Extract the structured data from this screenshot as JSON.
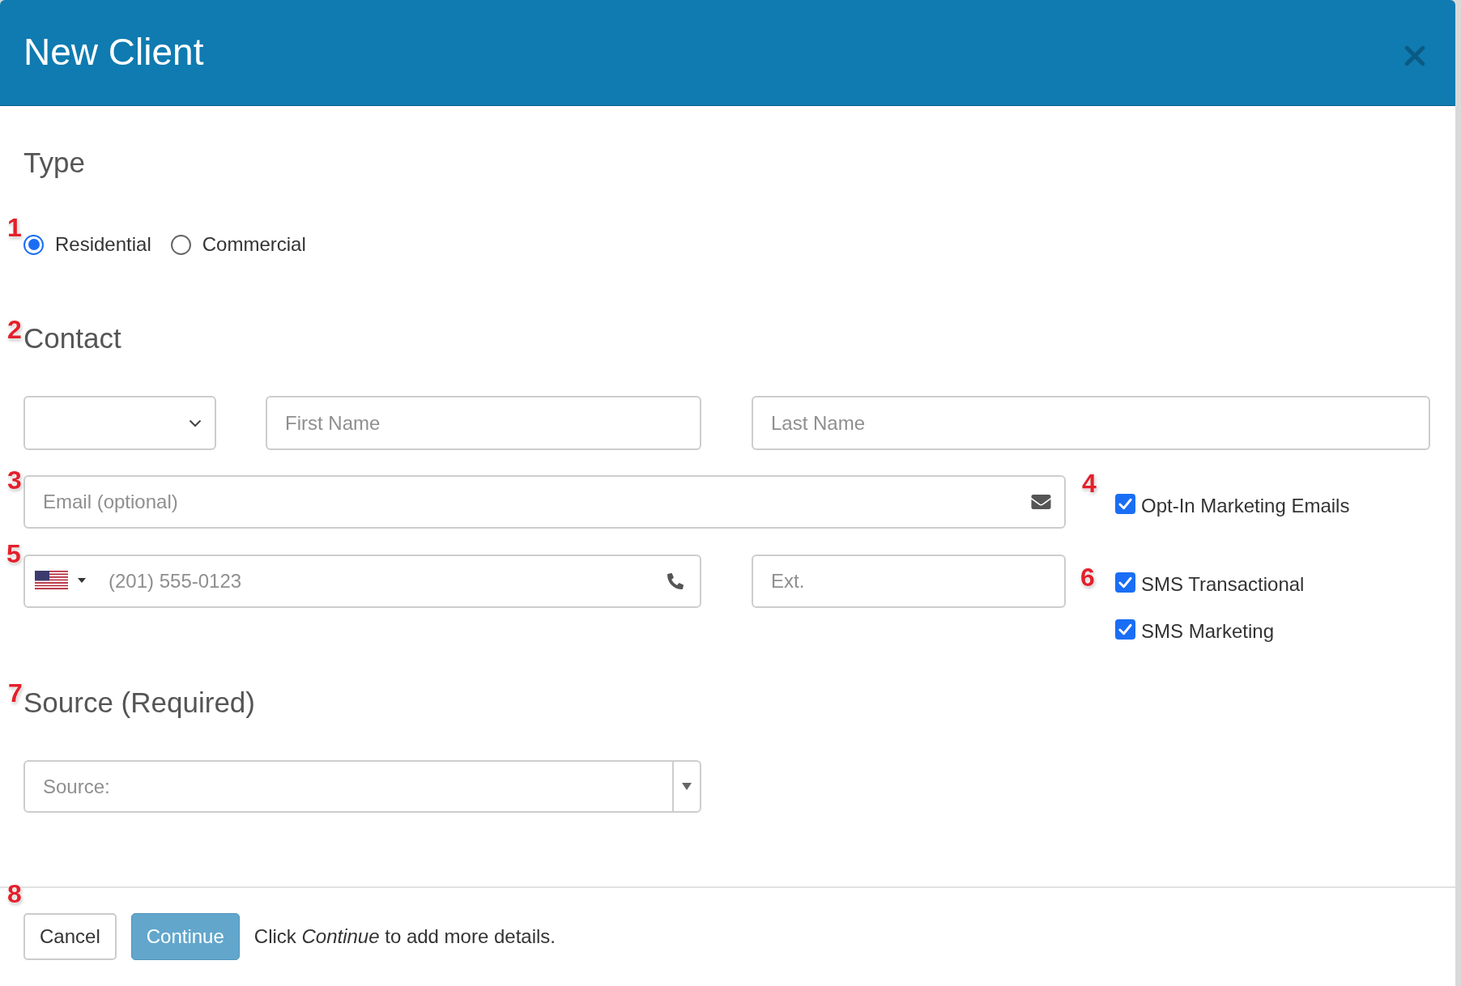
{
  "dialog": {
    "title": "New Client"
  },
  "type_section": {
    "heading": "Type",
    "callout": "1",
    "options": [
      {
        "label": "Residential",
        "selected": true
      },
      {
        "label": "Commercial",
        "selected": false
      }
    ]
  },
  "contact_section": {
    "heading": "Contact",
    "callout": "2",
    "first_name": {
      "placeholder": "First Name"
    },
    "last_name": {
      "placeholder": "Last Name"
    },
    "email": {
      "placeholder": "Email (optional)",
      "callout": "3"
    },
    "phone": {
      "placeholder": "(201) 555-0123",
      "callout": "5"
    },
    "extension": {
      "placeholder": "Ext."
    },
    "email_opt_ins": [
      {
        "label": "Opt-In Marketing Emails",
        "checked": true,
        "callout": "4"
      }
    ],
    "sms_opt_ins": [
      {
        "label": "SMS Transactional",
        "checked": true,
        "callout": "6"
      },
      {
        "label": "SMS Marketing",
        "checked": true
      }
    ]
  },
  "source_section": {
    "heading": "Source (Required)",
    "callout": "7",
    "source_select": {
      "placeholder": "Source:"
    }
  },
  "footer": {
    "callout": "8",
    "buttons": [
      {
        "label": "Cancel",
        "kind": "secondary",
        "disabled": false
      },
      {
        "label": "Continue",
        "kind": "primary",
        "disabled": true
      }
    ],
    "hint": "Click *Continue* to add more details."
  }
}
